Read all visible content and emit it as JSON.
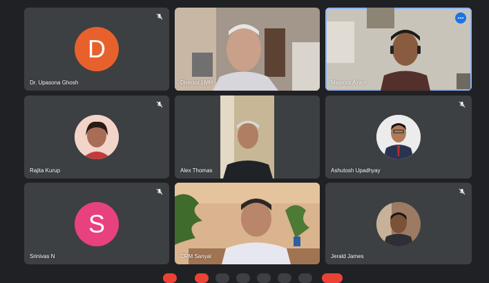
{
  "colors": {
    "background": "#202124",
    "tile": "#3c4043",
    "accent": "#1a73e8",
    "upasona_avatar": "#e8612c",
    "srinivas_avatar": "#e8417f",
    "end_call": "#ea4335"
  },
  "participants": [
    {
      "name": "Dr. Upasona Ghosh",
      "initial": "D",
      "muted": true,
      "video": false
    },
    {
      "name": "Director LMH",
      "muted": false,
      "video": true
    },
    {
      "name": "Masroor Azam",
      "muted": false,
      "video": true,
      "active_speaker": true
    },
    {
      "name": "Rajita Kurup",
      "muted": true,
      "video": false
    },
    {
      "name": "Alex Thomas",
      "muted": false,
      "video": true
    },
    {
      "name": "Ashutosh Upadhyay",
      "muted": true,
      "video": false
    },
    {
      "name": "Srinivas N",
      "initial": "S",
      "muted": true,
      "video": false
    },
    {
      "name": "CRM Sanyal",
      "muted": false,
      "video": true
    },
    {
      "name": "Jerald James",
      "muted": true,
      "video": false
    }
  ],
  "icons": {
    "muted": "mic-off-icon",
    "more": "more-options-icon"
  }
}
